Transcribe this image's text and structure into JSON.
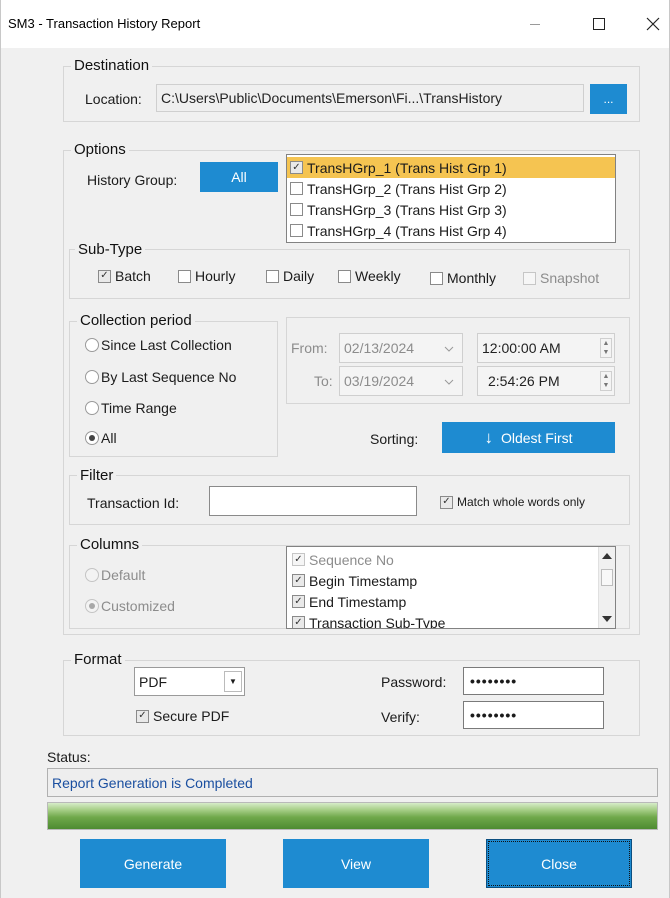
{
  "window": {
    "title": "SM3 - Transaction History Report"
  },
  "destination": {
    "title": "Destination",
    "location_label": "Location:",
    "location_value": "C:\\Users\\Public\\Documents\\Emerson\\Fi...\\TransHistory",
    "browse_label": "..."
  },
  "options": {
    "title": "Options",
    "history_group_label": "History Group:",
    "all_button": "All",
    "groups": [
      {
        "label": "TransHGrp_1 (Trans Hist Grp 1)",
        "checked": true,
        "selected": true
      },
      {
        "label": "TransHGrp_2 (Trans Hist Grp 2)",
        "checked": false,
        "selected": false
      },
      {
        "label": "TransHGrp_3 (Trans Hist Grp 3)",
        "checked": false,
        "selected": false
      },
      {
        "label": "TransHGrp_4 (Trans Hist Grp 4)",
        "checked": false,
        "selected": false
      }
    ]
  },
  "subtype": {
    "title": "Sub-Type",
    "items": [
      {
        "label": "Batch",
        "checked": true,
        "enabled": true
      },
      {
        "label": "Hourly",
        "checked": false,
        "enabled": true
      },
      {
        "label": "Daily",
        "checked": false,
        "enabled": true
      },
      {
        "label": "Weekly",
        "checked": false,
        "enabled": true
      },
      {
        "label": "Monthly",
        "checked": false,
        "enabled": true
      },
      {
        "label": "Snapshot",
        "checked": false,
        "enabled": false
      }
    ]
  },
  "collection": {
    "title": "Collection period",
    "options": [
      {
        "label": "Since Last Collection",
        "selected": false
      },
      {
        "label": "By Last Sequence No",
        "selected": false
      },
      {
        "label": "Time Range",
        "selected": false
      },
      {
        "label": "All",
        "selected": true
      }
    ],
    "from_label": "From:",
    "from_date": "02/13/2024",
    "from_time": "12:00:00 AM",
    "to_label": "To:",
    "to_date": "03/19/2024",
    "to_time": "2:54:26 PM"
  },
  "sorting": {
    "label": "Sorting:",
    "button": "Oldest First",
    "arrow": "↓"
  },
  "filter": {
    "title": "Filter",
    "transaction_label": "Transaction Id:",
    "transaction_value": "",
    "match_label": "Match whole words only",
    "match_checked": true
  },
  "columns": {
    "title": "Columns",
    "options": [
      {
        "label": "Default",
        "selected": false
      },
      {
        "label": "Customized",
        "selected": true
      }
    ],
    "items": [
      {
        "label": "Sequence No",
        "checked": true,
        "enabled": false
      },
      {
        "label": "Begin Timestamp",
        "checked": true,
        "enabled": true
      },
      {
        "label": "End Timestamp",
        "checked": true,
        "enabled": true
      },
      {
        "label": "Transaction Sub-Type",
        "checked": true,
        "enabled": true
      }
    ]
  },
  "format": {
    "title": "Format",
    "type_value": "PDF",
    "secure_label": "Secure PDF",
    "secure_checked": true,
    "password_label": "Password:",
    "password_mask": "••••••••",
    "verify_label": "Verify:",
    "verify_mask": "••••••••"
  },
  "status": {
    "label": "Status:",
    "message": "Report Generation is Completed",
    "progress": 1.0
  },
  "buttons": {
    "generate": "Generate",
    "view": "View",
    "close": "Close"
  },
  "colors": {
    "accent": "#1e8bd1",
    "selection": "#f5c451",
    "status_text": "#1a4fa0"
  }
}
